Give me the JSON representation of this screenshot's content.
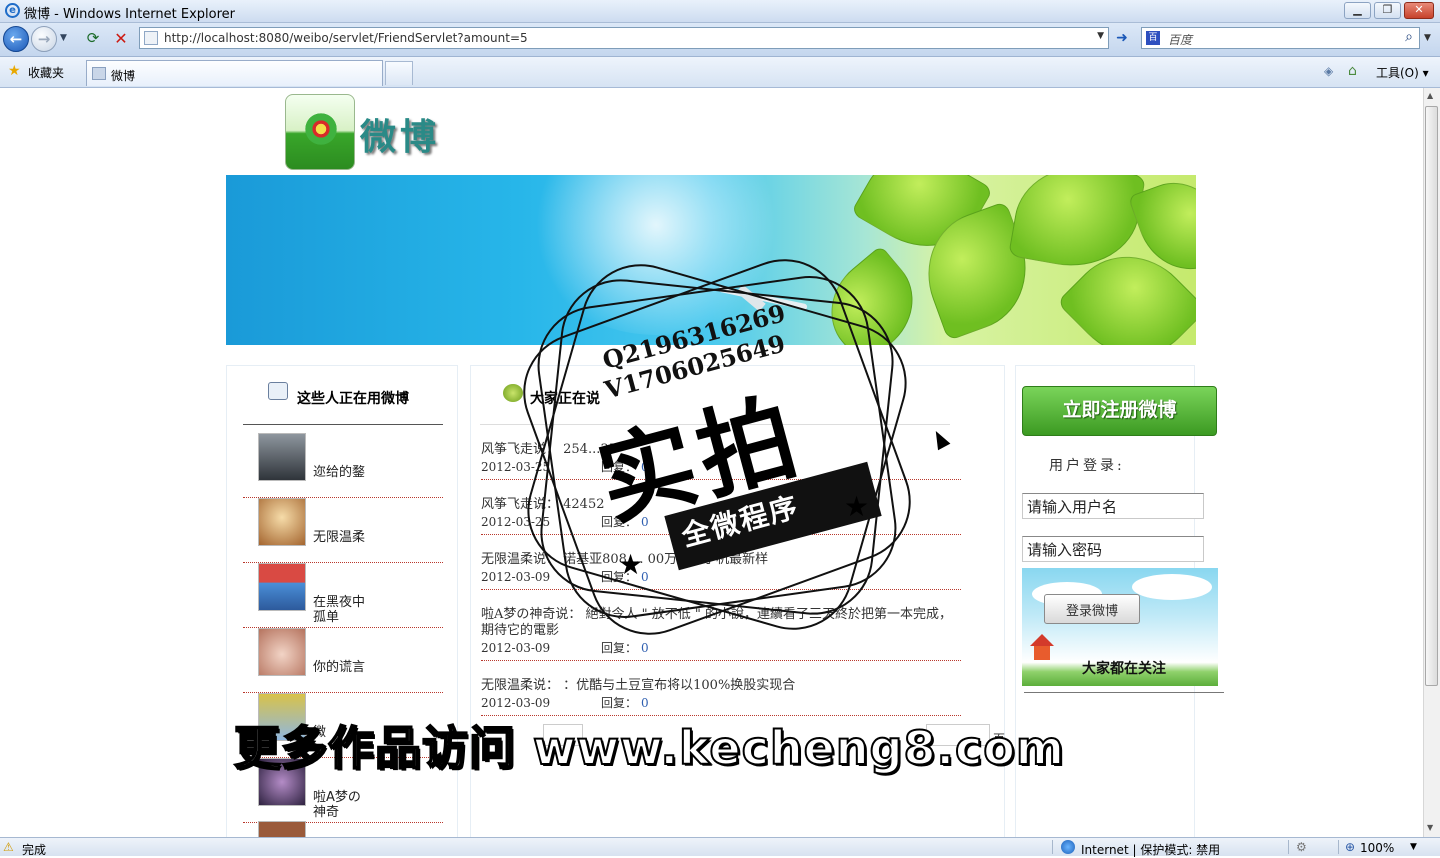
{
  "window": {
    "title": "微博 - Windows Internet Explorer",
    "minimize": "▁",
    "maximize": "❐",
    "close": "✕"
  },
  "nav": {
    "url": "http://localhost:8080/weibo/servlet/FriendServlet?amount=5",
    "search_placeholder": "百度",
    "search_icon_text": "百"
  },
  "favbar": {
    "favorites_label": "收藏夹",
    "tab_title": "微博",
    "tools_menu": "工具(O) ▾"
  },
  "page": {
    "logo_text": "微博",
    "left_heading": "这些人正在用微博",
    "users": [
      {
        "name": "迩给的鍪",
        "avatar_color": "#5b5f66"
      },
      {
        "name": "无限温柔",
        "avatar_color": "#e7c89a"
      },
      {
        "name": "在黑夜中孤单",
        "avatar_color": "#d9534f"
      },
      {
        "name": "你的谎言",
        "avatar_color": "#d8a99a"
      },
      {
        "name": "微",
        "avatar_color": "#a7c7e8"
      },
      {
        "name": "啦A梦の神奇",
        "avatar_color": "#4a3b5a"
      }
    ],
    "mid_heading": "大家正在说",
    "posts": [
      {
        "text": "风筝飞走说：  254...35",
        "date": "2012-03-25",
        "reply_label": "回复：",
        "reply_count": "0"
      },
      {
        "text": "风筝飞走说：  42452",
        "date": "2012-03-25",
        "reply_label": "回复：",
        "reply_count": "0"
      },
      {
        "text": "无限温柔说：  诺基亚808  ...  00万像素手机最新样",
        "date": "2012-03-09",
        "reply_label": "回复：",
        "reply_count": "0"
      },
      {
        "text": "啦A梦の神奇说：  絕對令人 \" 放不低 \" 的小說，連續看了三天終於把第一本完成，期待它的電影",
        "date": "2012-03-09",
        "reply_label": "回复：",
        "reply_count": "0"
      },
      {
        "text": "无限温柔说：  ：优酷与土豆宣布将以100%换股实现合",
        "date": "2012-03-09",
        "reply_label": "回复：",
        "reply_count": "0"
      }
    ],
    "pager_suffix": "页",
    "register_button": "立即注册微博",
    "login_label": "用户登录:",
    "username_placeholder": "请输入用户名",
    "password_placeholder": "请输入密码",
    "login_button": "登录微博",
    "follow_heading": "大家都在关注"
  },
  "overlay": {
    "qq": "Q2196316269",
    "wechat": "V1706025649",
    "big_text": "实拍",
    "ribbon_text": "全微程序",
    "promo": "更多作品访问 www.kecheng8.com"
  },
  "status": {
    "text": "完成",
    "zone": "Internet | 保护模式: 禁用",
    "zoom": "100%"
  },
  "colors": {
    "register_green": "#3c9a22",
    "link_blue": "#2f5fb0",
    "dotted_rule_red": "#b9382d"
  }
}
